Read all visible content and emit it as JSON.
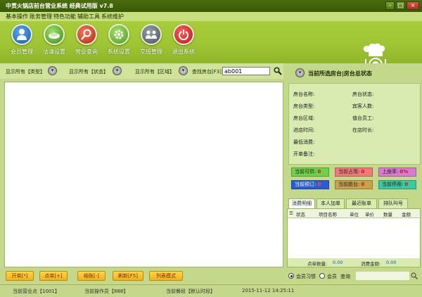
{
  "window": {
    "title": "中贯火锅店前台营业系统 经典试用版 v7.8",
    "buttons": {
      "minimize": "–",
      "maximize": "□",
      "close": "×"
    }
  },
  "menu": [
    "基本操作",
    "账务管理",
    "特色功能",
    "辅助工具",
    "系统维护"
  ],
  "toolbar": [
    {
      "label": "会员管理",
      "icon": "member-icon"
    },
    {
      "label": "沽清设置",
      "icon": "dish-icon"
    },
    {
      "label": "营业查询",
      "icon": "search-icon"
    },
    {
      "label": "系统设置",
      "icon": "gear-icon"
    },
    {
      "label": "交班管理",
      "icon": "shift-icon"
    },
    {
      "label": "退出系统",
      "icon": "power-icon"
    }
  ],
  "filters": {
    "type": "显示所有【类型】",
    "status": "显示所有【状态】",
    "area": "显示所有【区域】",
    "search_label": "查找房台[F3]",
    "search_value": "ab001"
  },
  "actions": [
    "开单[*]",
    "点单[+]",
    "结账[-]",
    "刷新[F5]",
    "列表模式"
  ],
  "right_panel": {
    "title": "当前所选房台|房台总状态",
    "fields_left": [
      "房台名称:",
      "房台类型:",
      "房台区域:",
      "进店时间:",
      "最低消费:",
      "开单备注:"
    ],
    "fields_right": [
      "房台状态:",
      "宾客人数:",
      "值台员工:",
      "在店时长:"
    ],
    "status": [
      {
        "label": "当前可供:",
        "value": "0",
        "color": "#6fd14a"
      },
      {
        "label": "当前占用:",
        "value": "0",
        "color": "#f07a7a"
      },
      {
        "label": "上座率:",
        "value": "0%",
        "color": "#d77ad0"
      },
      {
        "label": "当前预订:",
        "value": "0",
        "color": "#2a5bd1"
      },
      {
        "label": "当前脏台:",
        "value": "0",
        "color": "#c9a24e"
      },
      {
        "label": "当前停用:",
        "value": "0",
        "color": "#3cc8a0"
      }
    ],
    "tabs": [
      "消费明细",
      "本人加单",
      "最近账单",
      "排队叫号"
    ],
    "columns": [
      "☰",
      "状态",
      "项目名称",
      "单位",
      "单价",
      "数量",
      "金额"
    ],
    "footer": {
      "count_label": "点单数量:",
      "count_value": "0.00",
      "amount_label": "消费金额:",
      "amount_value": "0.00"
    },
    "options": {
      "opt1": "会员习惯",
      "opt2": "会员",
      "opt3": "查询"
    }
  },
  "statusbar": {
    "point": "当前营业点【1001】",
    "operator": "当前操作员【888】",
    "period": "当前餐段【默认时段】",
    "time": "2015-11-12 14:25:11"
  }
}
